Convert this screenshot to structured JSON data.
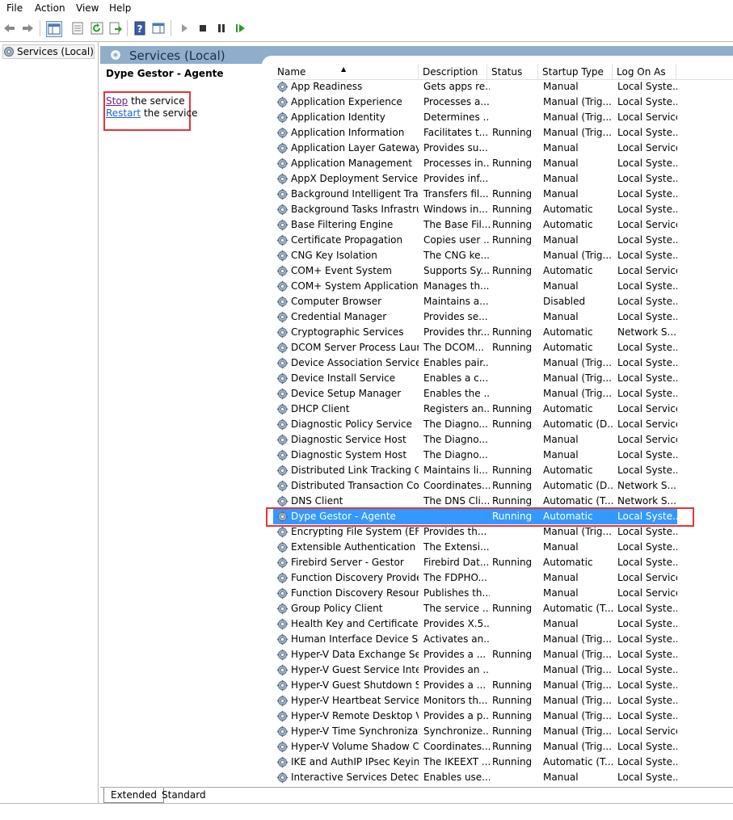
{
  "menu": [
    "File",
    "Action",
    "View",
    "Help"
  ],
  "toolbar": {
    "buttons": [
      "back-arrow-icon",
      "forward-arrow-icon",
      "show-hide-console-tree-icon",
      "properties-icon",
      "refresh-icon",
      "export-list-icon",
      "help-icon",
      "action-pane-icon",
      "start-service-icon",
      "stop-service-icon",
      "pause-service-icon",
      "resume-service-icon"
    ]
  },
  "tree": {
    "root_label": "Services (Local)"
  },
  "header": {
    "title": "Services (Local)"
  },
  "details": {
    "service_name": "Dype Gestor - Agente",
    "stop_link": "Stop",
    "stop_suffix": " the service",
    "restart_link": "Restart",
    "restart_suffix": " the service"
  },
  "columns": {
    "name": "Name",
    "description": "Description",
    "status": "Status",
    "startup": "Startup Type",
    "logon": "Log On As"
  },
  "services": [
    {
      "name": "App Readiness",
      "desc": "Gets apps re...",
      "status": "",
      "startup": "Manual",
      "logon": "Local Syste..."
    },
    {
      "name": "Application Experience",
      "desc": "Processes a...",
      "status": "",
      "startup": "Manual (Trig...",
      "logon": "Local Syste..."
    },
    {
      "name": "Application Identity",
      "desc": "Determines ...",
      "status": "",
      "startup": "Manual (Trig...",
      "logon": "Local Service"
    },
    {
      "name": "Application Information",
      "desc": "Facilitates t...",
      "status": "Running",
      "startup": "Manual (Trig...",
      "logon": "Local Syste..."
    },
    {
      "name": "Application Layer Gateway ...",
      "desc": "Provides su...",
      "status": "",
      "startup": "Manual",
      "logon": "Local Service"
    },
    {
      "name": "Application Management",
      "desc": "Processes in...",
      "status": "Running",
      "startup": "Manual",
      "logon": "Local Syste..."
    },
    {
      "name": "AppX Deployment Service (...",
      "desc": "Provides inf...",
      "status": "",
      "startup": "Manual",
      "logon": "Local Syste..."
    },
    {
      "name": "Background Intelligent Tran...",
      "desc": "Transfers fil...",
      "status": "Running",
      "startup": "Manual",
      "logon": "Local Syste..."
    },
    {
      "name": "Background Tasks Infrastru...",
      "desc": "Windows in...",
      "status": "Running",
      "startup": "Automatic",
      "logon": "Local Syste..."
    },
    {
      "name": "Base Filtering Engine",
      "desc": "The Base Fil...",
      "status": "Running",
      "startup": "Automatic",
      "logon": "Local Service"
    },
    {
      "name": "Certificate Propagation",
      "desc": "Copies user ...",
      "status": "Running",
      "startup": "Manual",
      "logon": "Local Syste..."
    },
    {
      "name": "CNG Key Isolation",
      "desc": "The CNG ke...",
      "status": "",
      "startup": "Manual (Trig...",
      "logon": "Local Syste..."
    },
    {
      "name": "COM+ Event System",
      "desc": "Supports Sy...",
      "status": "Running",
      "startup": "Automatic",
      "logon": "Local Service"
    },
    {
      "name": "COM+ System Application",
      "desc": "Manages th...",
      "status": "",
      "startup": "Manual",
      "logon": "Local Syste..."
    },
    {
      "name": "Computer Browser",
      "desc": "Maintains a...",
      "status": "",
      "startup": "Disabled",
      "logon": "Local Syste..."
    },
    {
      "name": "Credential Manager",
      "desc": "Provides se...",
      "status": "",
      "startup": "Manual",
      "logon": "Local Syste..."
    },
    {
      "name": "Cryptographic Services",
      "desc": "Provides thr...",
      "status": "Running",
      "startup": "Automatic",
      "logon": "Network S..."
    },
    {
      "name": "DCOM Server Process Laun...",
      "desc": "The DCOM...",
      "status": "Running",
      "startup": "Automatic",
      "logon": "Local Syste..."
    },
    {
      "name": "Device Association Service",
      "desc": "Enables pair...",
      "status": "",
      "startup": "Manual (Trig...",
      "logon": "Local Syste..."
    },
    {
      "name": "Device Install Service",
      "desc": "Enables a c...",
      "status": "",
      "startup": "Manual (Trig...",
      "logon": "Local Syste..."
    },
    {
      "name": "Device Setup Manager",
      "desc": "Enables the ...",
      "status": "",
      "startup": "Manual (Trig...",
      "logon": "Local Syste..."
    },
    {
      "name": "DHCP Client",
      "desc": "Registers an...",
      "status": "Running",
      "startup": "Automatic",
      "logon": "Local Service"
    },
    {
      "name": "Diagnostic Policy Service",
      "desc": "The Diagno...",
      "status": "Running",
      "startup": "Automatic (D...",
      "logon": "Local Service"
    },
    {
      "name": "Diagnostic Service Host",
      "desc": "The Diagno...",
      "status": "",
      "startup": "Manual",
      "logon": "Local Service"
    },
    {
      "name": "Diagnostic System Host",
      "desc": "The Diagno...",
      "status": "",
      "startup": "Manual",
      "logon": "Local Syste..."
    },
    {
      "name": "Distributed Link Tracking Cl...",
      "desc": "Maintains li...",
      "status": "Running",
      "startup": "Automatic",
      "logon": "Local Syste..."
    },
    {
      "name": "Distributed Transaction Co...",
      "desc": "Coordinates...",
      "status": "Running",
      "startup": "Automatic (D...",
      "logon": "Network S..."
    },
    {
      "name": "DNS Client",
      "desc": "The DNS Cli...",
      "status": "Running",
      "startup": "Automatic (T...",
      "logon": "Network S..."
    },
    {
      "name": "Dype Gestor - Agente",
      "desc": "",
      "status": "Running",
      "startup": "Automatic",
      "logon": "Local Syste...",
      "selected": true
    },
    {
      "name": "Encrypting File System (EFS)",
      "desc": "Provides th...",
      "status": "",
      "startup": "Manual (Trig...",
      "logon": "Local Syste..."
    },
    {
      "name": "Extensible Authentication P...",
      "desc": "The Extensi...",
      "status": "",
      "startup": "Manual",
      "logon": "Local Syste..."
    },
    {
      "name": "Firebird Server - Gestor",
      "desc": "Firebird Dat...",
      "status": "Running",
      "startup": "Automatic",
      "logon": "Local Syste..."
    },
    {
      "name": "Function Discovery Provide...",
      "desc": "The FDPHO...",
      "status": "",
      "startup": "Manual",
      "logon": "Local Service"
    },
    {
      "name": "Function Discovery Resourc...",
      "desc": "Publishes th...",
      "status": "",
      "startup": "Manual",
      "logon": "Local Service"
    },
    {
      "name": "Group Policy Client",
      "desc": "The service ...",
      "status": "Running",
      "startup": "Automatic (T...",
      "logon": "Local Syste..."
    },
    {
      "name": "Health Key and Certificate ...",
      "desc": "Provides X.5...",
      "status": "",
      "startup": "Manual",
      "logon": "Local Syste..."
    },
    {
      "name": "Human Interface Device Ser...",
      "desc": "Activates an...",
      "status": "",
      "startup": "Manual (Trig...",
      "logon": "Local Syste..."
    },
    {
      "name": "Hyper-V Data Exchange Ser...",
      "desc": "Provides a ...",
      "status": "Running",
      "startup": "Manual (Trig...",
      "logon": "Local Syste..."
    },
    {
      "name": "Hyper-V Guest Service Inter...",
      "desc": "Provides an ...",
      "status": "",
      "startup": "Manual (Trig...",
      "logon": "Local Syste..."
    },
    {
      "name": "Hyper-V Guest Shutdown S...",
      "desc": "Provides a ...",
      "status": "Running",
      "startup": "Manual (Trig...",
      "logon": "Local Syste..."
    },
    {
      "name": "Hyper-V Heartbeat Service",
      "desc": "Monitors th...",
      "status": "Running",
      "startup": "Manual (Trig...",
      "logon": "Local Syste..."
    },
    {
      "name": "Hyper-V Remote Desktop Vi...",
      "desc": "Provides a p...",
      "status": "Running",
      "startup": "Manual (Trig...",
      "logon": "Local Syste..."
    },
    {
      "name": "Hyper-V Time Synchronizat...",
      "desc": "Synchronize...",
      "status": "Running",
      "startup": "Manual (Trig...",
      "logon": "Local Service"
    },
    {
      "name": "Hyper-V Volume Shadow C...",
      "desc": "Coordinates...",
      "status": "Running",
      "startup": "Manual (Trig...",
      "logon": "Local Syste..."
    },
    {
      "name": "IKE and AuthIP IPsec Keying...",
      "desc": "The IKEEXT ...",
      "status": "Running",
      "startup": "Automatic (T...",
      "logon": "Local Syste..."
    },
    {
      "name": "Interactive Services Detection",
      "desc": "Enables use...",
      "status": "",
      "startup": "Manual",
      "logon": "Local Syste..."
    }
  ],
  "tabs": {
    "extended": "Extended",
    "standard": "Standard"
  },
  "colors": {
    "selection": "#3399ff",
    "highlight_box": "#e5333a",
    "header_band": "#90aecb"
  }
}
